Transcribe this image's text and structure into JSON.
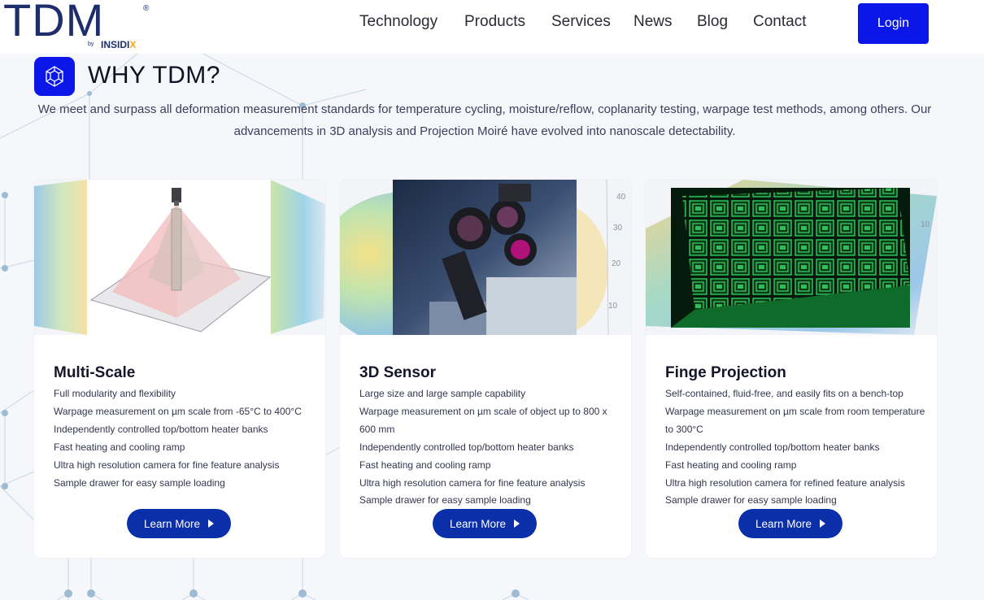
{
  "brand": {
    "logo_text": "TDM",
    "logo_reg": "®",
    "logo_by": "by",
    "logo_brand_main": "INSIDI",
    "logo_brand_x": "X"
  },
  "nav": {
    "items": [
      "Technology",
      "Products",
      "Services",
      "News",
      "Blog",
      "Contact"
    ],
    "login_label": "Login"
  },
  "section": {
    "title": "WHY TDM?",
    "intro": "We meet and surpass all deformation measurement standards for temperature cycling, moisture/reflow, coplanarity testing, warpage test methods, among others. Our advancements in 3D analysis and Projection Moiré have evolved into nanoscale detectability."
  },
  "cards": [
    {
      "title": "Multi-Scale",
      "features": [
        "Full modularity and flexibility",
        "Warpage measurement on µm scale from -65°C to 400°C",
        "Independently controlled top/bottom heater banks",
        "Fast heating and cooling ramp",
        "Ultra high resolution camera for fine feature analysis",
        "Sample drawer for easy sample loading"
      ],
      "button": "Learn More"
    },
    {
      "title": "3D Sensor",
      "features": [
        "Large size and large sample capability",
        "Warpage measurement on µm scale of object up to 800 x 600 mm",
        "Independently controlled top/bottom heater banks",
        "Fast heating and cooling ramp",
        "Ultra high resolution camera for fine feature analysis",
        "Sample drawer for easy sample loading"
      ],
      "button": "Learn More",
      "image_axis_labels": [
        "40",
        "30",
        "20",
        "10"
      ]
    },
    {
      "title": "Finge Projection",
      "features": [
        "Self-contained, fluid-free, and easily fits on a bench-top",
        "Warpage measurement on µm scale from room temperature to 300°C",
        "Independently controlled top/bottom heater banks",
        "Fast heating and cooling ramp",
        "Ultra high resolution camera for refined feature analysis",
        "Sample drawer for easy sample loading"
      ],
      "button": "Learn More",
      "image_axis_labels": [
        "10"
      ]
    }
  ],
  "colors": {
    "accent": "#0a17e8",
    "button": "#0a2fa8",
    "logo": "#1d2e6b",
    "logo_x": "#f2a91b"
  },
  "icons": {
    "why": "network-cube-icon",
    "button_caret": "caret-right-icon"
  }
}
